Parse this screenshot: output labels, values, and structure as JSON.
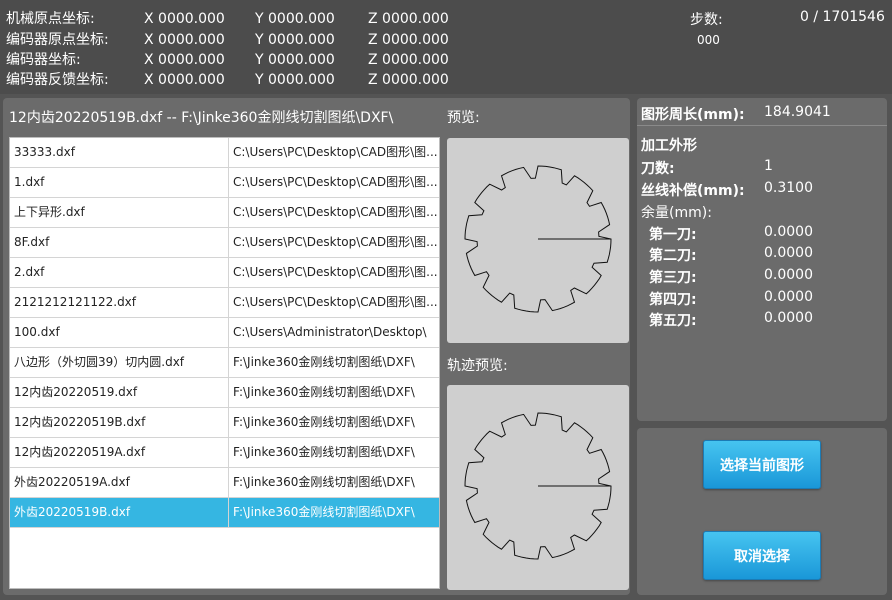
{
  "coords": {
    "rows": [
      {
        "label": "机械原点坐标:",
        "x": "X  0000.000",
        "y": "Y  0000.000",
        "z": "Z  0000.000"
      },
      {
        "label": "编码器原点坐标:",
        "x": "X  0000.000",
        "y": "Y  0000.000",
        "z": "Z  0000.000"
      },
      {
        "label": "编码器坐标:",
        "x": "X  0000.000",
        "y": "Y  0000.000",
        "z": "Z  0000.000"
      },
      {
        "label": "编码器反馈坐标:",
        "x": "X  0000.000",
        "y": "Y  0000.000",
        "z": "Z  0000.000"
      }
    ],
    "steps_label": "步数:",
    "steps_value": "0 / 1701546",
    "steps_sub": "000"
  },
  "file_panel": {
    "title": "12内齿20220519B.dxf -- F:\\Jinke360金刚线切割图纸\\DXF\\",
    "files": [
      {
        "name": "33333.dxf",
        "path": "C:\\Users\\PC\\Desktop\\CAD图形\\图..."
      },
      {
        "name": "1.dxf",
        "path": "C:\\Users\\PC\\Desktop\\CAD图形\\图..."
      },
      {
        "name": "上下异形.dxf",
        "path": "C:\\Users\\PC\\Desktop\\CAD图形\\图..."
      },
      {
        "name": "8F.dxf",
        "path": "C:\\Users\\PC\\Desktop\\CAD图形\\图..."
      },
      {
        "name": "2.dxf",
        "path": "C:\\Users\\PC\\Desktop\\CAD图形\\图..."
      },
      {
        "name": "2121212121122.dxf",
        "path": "C:\\Users\\PC\\Desktop\\CAD图形\\图..."
      },
      {
        "name": "100.dxf",
        "path": "C:\\Users\\Administrator\\Desktop\\"
      },
      {
        "name": "八边形（外切圆39）切内圆.dxf",
        "path": "F:\\Jinke360金刚线切割图纸\\DXF\\"
      },
      {
        "name": "12内齿20220519.dxf",
        "path": "F:\\Jinke360金刚线切割图纸\\DXF\\"
      },
      {
        "name": "12内齿20220519B.dxf",
        "path": "F:\\Jinke360金刚线切割图纸\\DXF\\"
      },
      {
        "name": "12内齿20220519A.dxf",
        "path": "F:\\Jinke360金刚线切割图纸\\DXF\\"
      },
      {
        "name": "外齿20220519A.dxf",
        "path": "F:\\Jinke360金刚线切割图纸\\DXF\\"
      },
      {
        "name": "外齿20220519B.dxf",
        "path": "F:\\Jinke360金刚线切割图纸\\DXF\\"
      }
    ],
    "selected_index": 12
  },
  "preview": {
    "label": "预览:",
    "track_label": "轨迹预览:"
  },
  "info": {
    "perimeter_label": "图形周长(mm):",
    "perimeter_value": "184.9041",
    "process_label": "加工外形",
    "cuts_label": "刀数:",
    "cuts_value": "1",
    "wire_comp_label": "丝线补偿(mm):",
    "wire_comp_value": "0.3100",
    "remainder_label": "余量(mm):",
    "passes": [
      {
        "label": "第一刀:",
        "value": "0.0000"
      },
      {
        "label": "第二刀:",
        "value": "0.0000"
      },
      {
        "label": "第三刀:",
        "value": "0.0000"
      },
      {
        "label": "第四刀:",
        "value": "0.0000"
      },
      {
        "label": "第五刀:",
        "value": "0.0000"
      }
    ]
  },
  "buttons": {
    "select_current": "选择当前图形",
    "cancel_select": "取消选择"
  },
  "colors": {
    "background": "#545454",
    "panel": "#6b6b6b",
    "selection": "#35b6e2",
    "button": "#2aa7e2"
  }
}
